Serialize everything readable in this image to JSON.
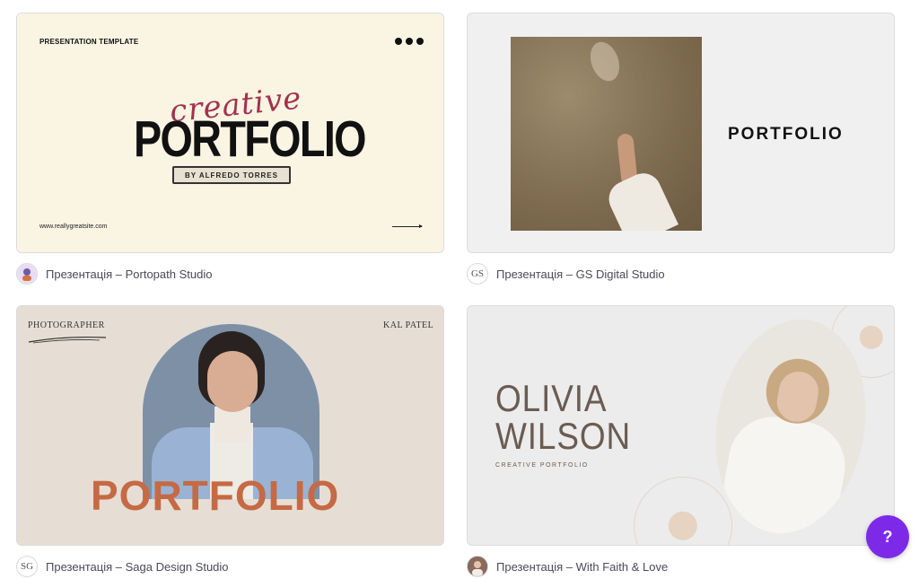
{
  "templates": [
    {
      "thumbnail": {
        "label": "PRESENTATION TEMPLATE",
        "script_word": "creative",
        "title": "PORTFOLIO",
        "byline": "BY ALFREDO TORRES",
        "url": "www.reallygreatsite.com"
      },
      "caption": "Презентація – Portopath Studio",
      "avatar_text": ""
    },
    {
      "thumbnail": {
        "title": "PORTFOLIO"
      },
      "caption": "Презентація – GS Digital Studio",
      "avatar_text": "GS"
    },
    {
      "thumbnail": {
        "label": "PHOTOGRAPHER",
        "name": "KAL PATEL",
        "title": "PORTFOLIO"
      },
      "caption": "Презентація – Saga Design Studio",
      "avatar_text": "SG"
    },
    {
      "thumbnail": {
        "name_line1": "OLIVIA",
        "name_line2": "WILSON",
        "subtitle": "CREATIVE PORTFOLIO"
      },
      "caption": "Презентація – With Faith & Love",
      "avatar_text": ""
    }
  ],
  "help_button": {
    "label": "?",
    "color": "#7d2ae8"
  },
  "colors": {
    "accent_red": "#a3324e",
    "accent_orange": "#c56a44"
  }
}
